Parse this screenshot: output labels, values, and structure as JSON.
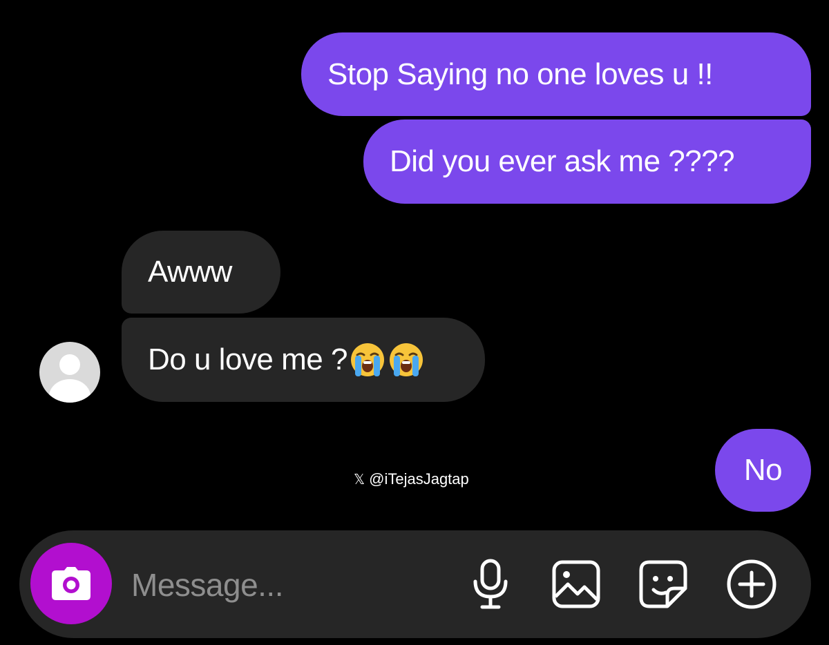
{
  "conversation": {
    "messages": [
      {
        "sender": "me",
        "text": "Stop Saying no one loves u !!"
      },
      {
        "sender": "me",
        "text": "Did you ever ask me ????"
      },
      {
        "sender": "them",
        "text": "Awww"
      },
      {
        "sender": "them",
        "text": "Do u love me ?",
        "emojis": [
          "loudly-crying-face-emoji",
          "loudly-crying-face-emoji"
        ]
      },
      {
        "sender": "me",
        "text": "No"
      }
    ],
    "contact_avatar": "default-avatar-icon"
  },
  "watermark": {
    "icon": "x-logo-icon",
    "handle": "@iTejasJagtap"
  },
  "composer": {
    "placeholder": "Message...",
    "icons": [
      "camera-icon",
      "microphone-icon",
      "gallery-icon",
      "sticker-icon",
      "plus-icon"
    ]
  },
  "colors": {
    "background": "#000000",
    "sent_bubble": "#7b48ec",
    "received_bubble": "#262626",
    "composer_bg": "#262626",
    "camera_button": "#b20fcf",
    "placeholder_text": "#8e8e8e",
    "text": "#ffffff"
  }
}
